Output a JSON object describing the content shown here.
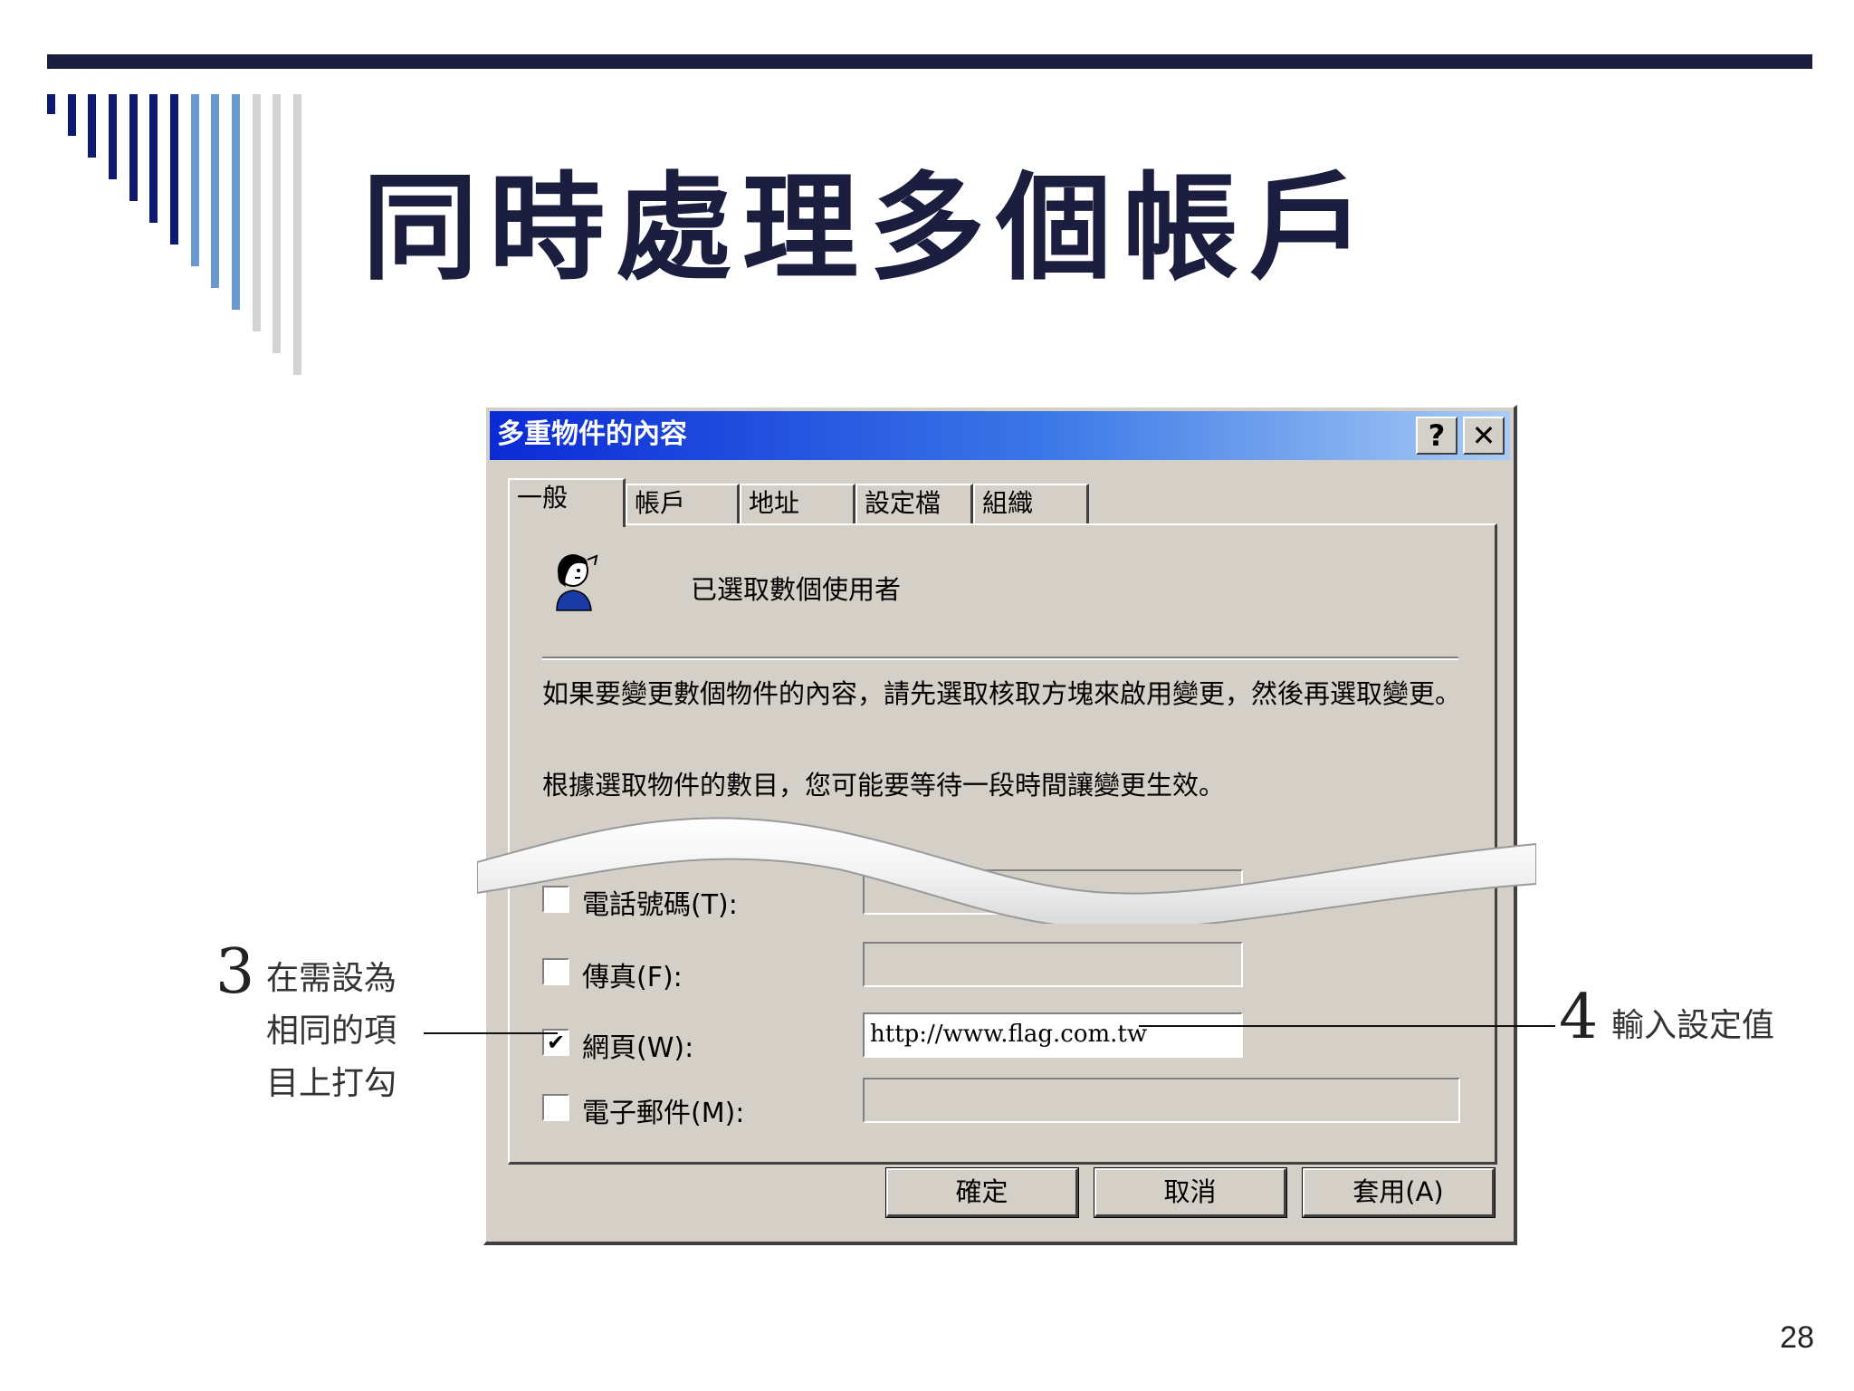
{
  "slide": {
    "title": "同時處理多個帳戶",
    "page_number": "28"
  },
  "dialog": {
    "title": "多重物件的內容",
    "help_icon": "?",
    "close_icon": "✕",
    "tabs": [
      {
        "label": "一般",
        "active": true
      },
      {
        "label": "帳戶",
        "active": false
      },
      {
        "label": "地址",
        "active": false
      },
      {
        "label": "設定檔",
        "active": false
      },
      {
        "label": "組織",
        "active": false
      }
    ],
    "icon": "users-icon",
    "users_selected": "已選取數個使用者",
    "description_1": "如果要變更數個物件的內容，請先選取核取方塊來啟用變更，然後再選取變更。",
    "description_2": "根據選取物件的數目，您可能要等待一段時間讓變更生效。",
    "fields": [
      {
        "label": "電話號碼(T):",
        "checked": false,
        "value": ""
      },
      {
        "label": "傳真(F):",
        "checked": false,
        "value": ""
      },
      {
        "label": "網頁(W):",
        "checked": true,
        "value": "http://www.flag.com.tw"
      },
      {
        "label": "電子郵件(M):",
        "checked": false,
        "value": ""
      }
    ],
    "buttons": {
      "ok": "確定",
      "cancel": "取消",
      "apply": "套用(A)"
    }
  },
  "callouts": {
    "step3_number": "3",
    "step3_line1": "在需設為",
    "step3_line2": "相同的項",
    "step3_line3": "目上打勾",
    "step4_number": "4",
    "step4_text": "輸入設定值"
  },
  "colors": {
    "title_text": "#1c1e3f",
    "titlebar_start": "#0a2ad6",
    "titlebar_end": "#a8ccf4",
    "dialog_bg": "#d4d0c8"
  }
}
